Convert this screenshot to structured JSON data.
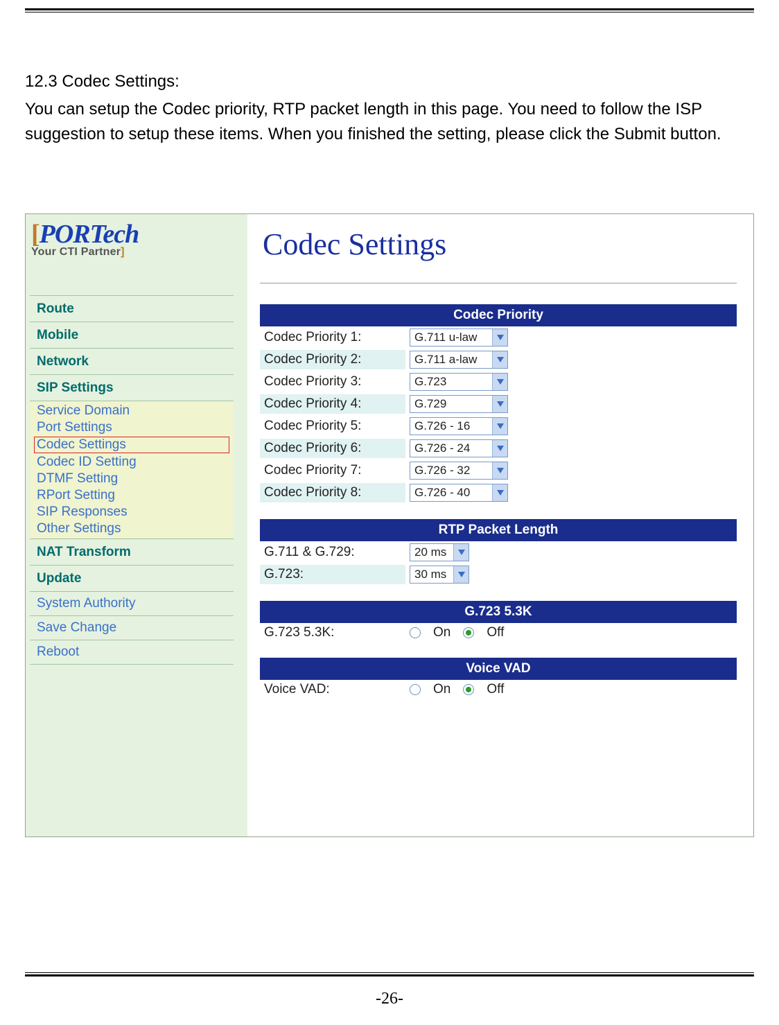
{
  "doc": {
    "section_title": "12.3 Codec Settings:",
    "paragraph": "You can setup the Codec priority, RTP packet length in this page. You need to follow the ISP suggestion to setup these items. When you finished the setting, please click the Submit button.",
    "page_number": "-26-"
  },
  "logo": {
    "name": "PORTech",
    "tagline": "Your CTI Partner"
  },
  "nav": {
    "route": "Route",
    "mobile": "Mobile",
    "network": "Network",
    "sip": "SIP Settings",
    "sip_sub": {
      "service_domain": "Service Domain",
      "port_settings": "Port Settings",
      "codec_settings": "Codec Settings",
      "codec_id_setting": "Codec ID Setting",
      "dtmf_setting": "DTMF Setting",
      "rport_setting": "RPort Setting",
      "sip_responses": "SIP Responses",
      "other_settings": "Other Settings"
    },
    "nat": "NAT Transform",
    "update": "Update",
    "system_authority": "System Authority",
    "save_change": "Save Change",
    "reboot": "Reboot"
  },
  "page_title": "Codec Settings",
  "codec_priority": {
    "header": "Codec Priority",
    "rows": [
      {
        "label": "Codec Priority 1:",
        "value": "G.711 u-law"
      },
      {
        "label": "Codec Priority 2:",
        "value": "G.711 a-law"
      },
      {
        "label": "Codec Priority 3:",
        "value": "G.723"
      },
      {
        "label": "Codec Priority 4:",
        "value": "G.729"
      },
      {
        "label": "Codec Priority 5:",
        "value": "G.726 - 16"
      },
      {
        "label": "Codec Priority 6:",
        "value": "G.726 - 24"
      },
      {
        "label": "Codec Priority 7:",
        "value": "G.726 - 32"
      },
      {
        "label": "Codec Priority 8:",
        "value": "G.726 - 40"
      }
    ]
  },
  "rtp": {
    "header": "RTP Packet Length",
    "rows": [
      {
        "label": "G.711 & G.729:",
        "value": "20 ms"
      },
      {
        "label": "G.723:",
        "value": "30 ms"
      }
    ]
  },
  "g723": {
    "header": "G.723 5.3K",
    "label": "G.723 5.3K:",
    "on": "On",
    "off": "Off",
    "value": "Off"
  },
  "vad": {
    "header": "Voice VAD",
    "label": "Voice VAD:",
    "on": "On",
    "off": "Off",
    "value": "Off"
  }
}
